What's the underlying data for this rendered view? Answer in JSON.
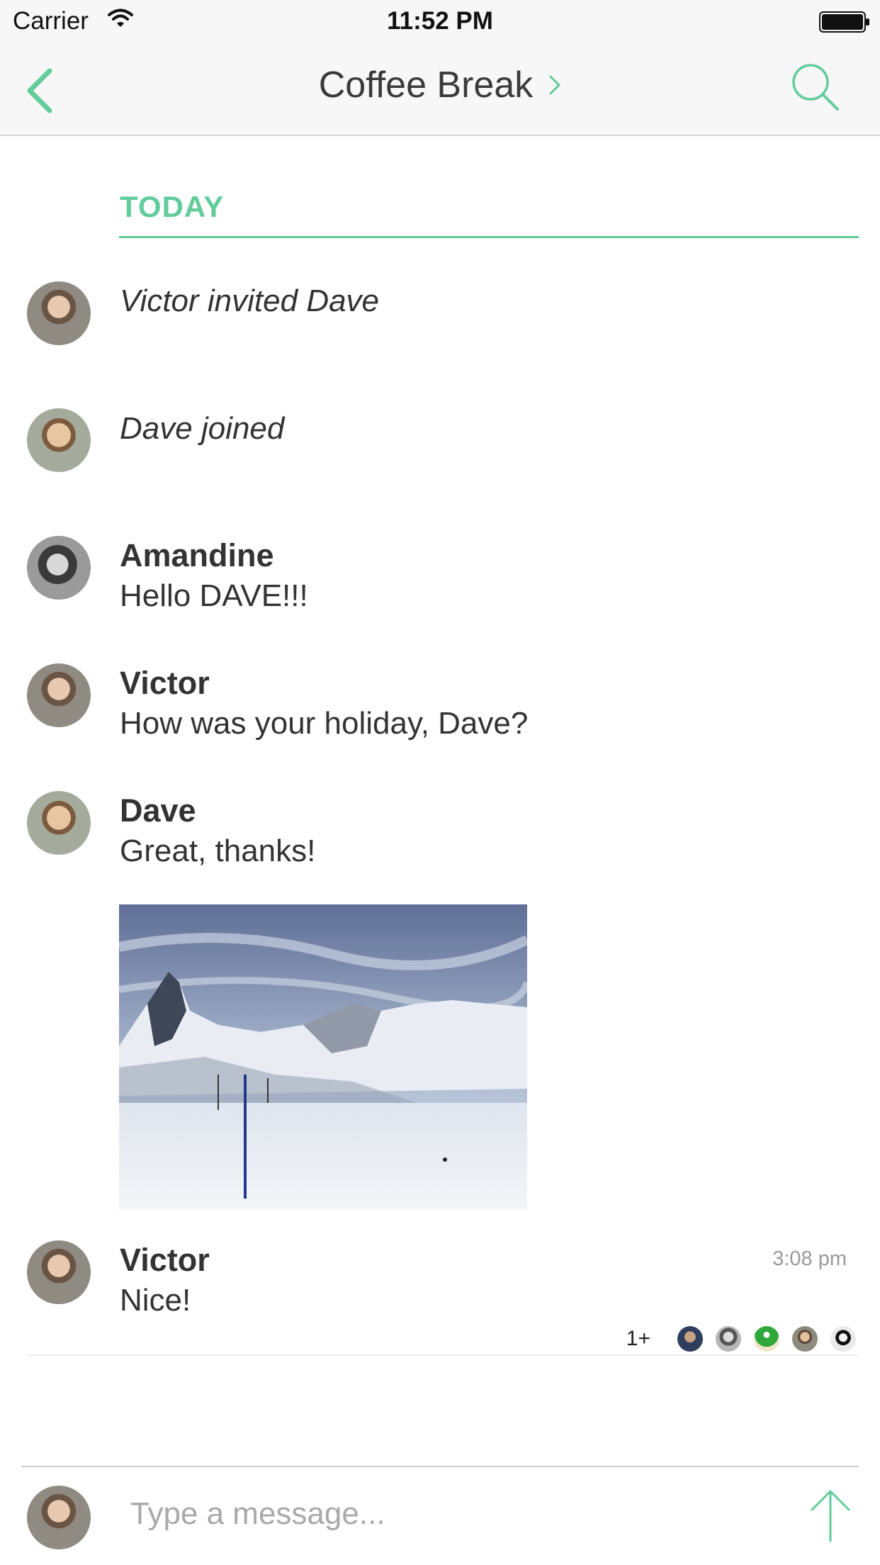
{
  "status_bar": {
    "carrier": "Carrier",
    "time": "11:52 PM"
  },
  "header": {
    "title": "Coffee Break",
    "accent_color": "#62cc9c"
  },
  "timeline": {
    "date_label": "TODAY",
    "events": [
      {
        "text": "Victor invited Dave",
        "avatar": "victor"
      },
      {
        "text": "Dave joined",
        "avatar": "dave"
      }
    ],
    "messages": [
      {
        "sender": "Amandine",
        "body": "Hello DAVE!!!"
      },
      {
        "sender": "Victor",
        "body": "How was your holiday, Dave?"
      },
      {
        "sender": "Dave",
        "body": "Great, thanks!",
        "attachment": "mountain-photo"
      },
      {
        "sender": "Victor",
        "body": "Nice!",
        "time": "3:08 pm"
      }
    ],
    "read_receipts": {
      "count_label": "1+"
    }
  },
  "composer": {
    "placeholder": "Type a message..."
  }
}
